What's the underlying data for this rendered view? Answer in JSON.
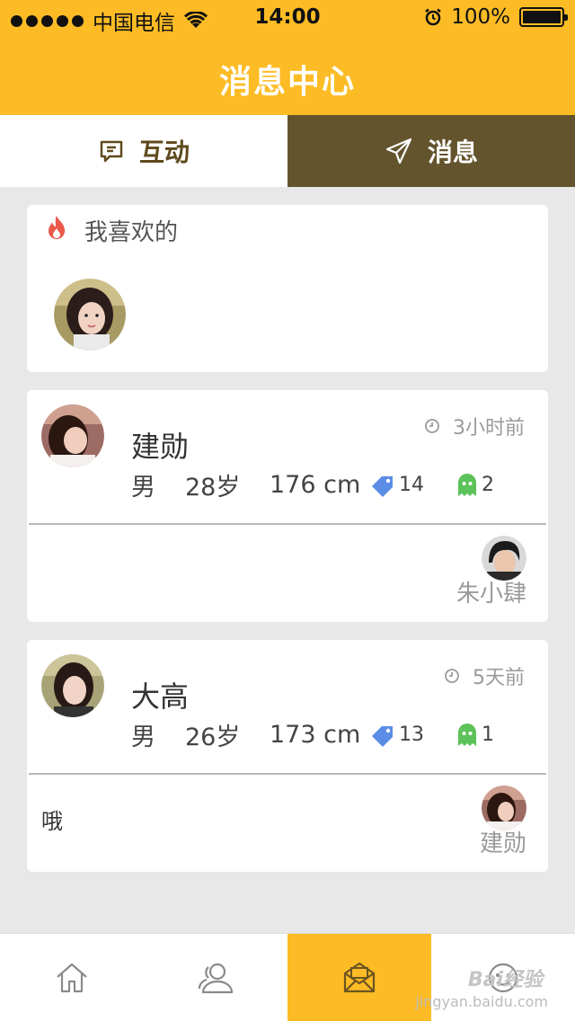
{
  "status_bar": {
    "carrier": "中国电信",
    "time": "14:00",
    "battery": "100%"
  },
  "header": {
    "title": "消息中心"
  },
  "tabs": [
    {
      "label": "互动",
      "icon": "chat-edit-icon",
      "active": false
    },
    {
      "label": "消息",
      "icon": "send-icon",
      "active": true
    }
  ],
  "likes": {
    "title": "我喜欢的",
    "icon": "fire-icon"
  },
  "messages": [
    {
      "name": "建勋",
      "time": "3小时前",
      "gender": "男",
      "age": "28岁",
      "height": "176 cm",
      "tag_count": "14",
      "ghost_count": "2",
      "text": "",
      "sender": "朱小肆"
    },
    {
      "name": "大高",
      "time": "5天前",
      "gender": "男",
      "age": "26岁",
      "height": "173 cm",
      "tag_count": "13",
      "ghost_count": "1",
      "text": "哦",
      "sender": "建勋"
    }
  ],
  "nav": [
    {
      "icon": "home-icon",
      "active": false
    },
    {
      "icon": "contacts-icon",
      "active": false
    },
    {
      "icon": "mail-icon",
      "active": true
    },
    {
      "icon": "profile-icon",
      "active": false
    }
  ],
  "watermark": {
    "logo": "Bai经验",
    "url": "jingyan.baidu.com"
  },
  "colors": {
    "brand": "#fdbc25",
    "tab_active": "#64542d",
    "tag": "#5b8ce6",
    "ghost": "#5cc25a",
    "fire": "#e9584a"
  }
}
